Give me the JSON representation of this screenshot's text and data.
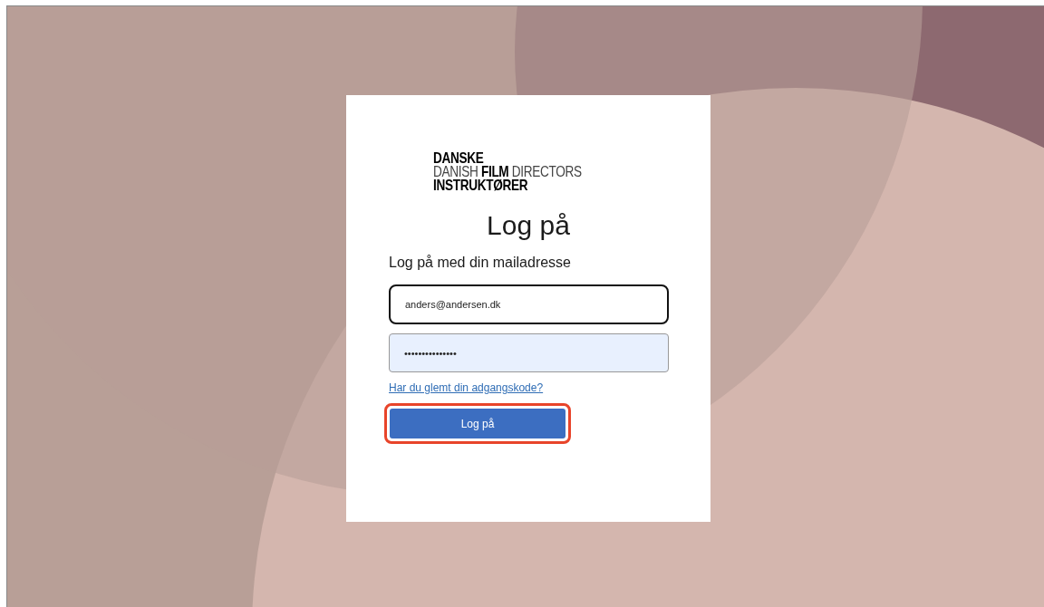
{
  "logo": {
    "line_1": "DANSKE",
    "line_2_light": "DANISH",
    "line_2_bold": "FILM",
    "line_2_light_end": "DIRECTORS",
    "line_3": "INSTRUKTØRER"
  },
  "title": "Log på",
  "subtitle": "Log på med din mailadresse",
  "email_field": {
    "value": "anders@andersen.dk"
  },
  "password_field": {
    "value": "•••••••••••••••",
    "autofilled": true
  },
  "forgot_link": "Har du glemt din adgangskode?",
  "submit_button": {
    "label": "Log på",
    "highlighted": true
  }
}
